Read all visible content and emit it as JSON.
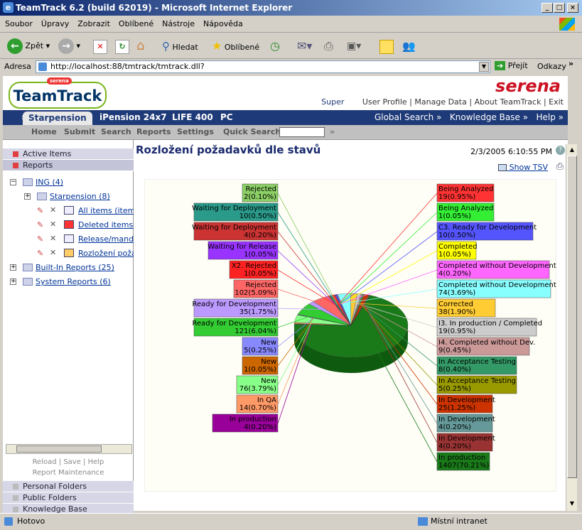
{
  "window": {
    "title": "TeamTrack 6.2 (build 62019) - Microsoft Internet Explorer",
    "min": "_",
    "max": "□",
    "close": "×"
  },
  "menu": [
    "Soubor",
    "Úpravy",
    "Zobrazit",
    "Oblíbené",
    "Nástroje",
    "Nápověda"
  ],
  "toolbar": {
    "back": "Zpět",
    "search": "Hledat",
    "favorites": "Oblíbené"
  },
  "address": {
    "label": "Adresa",
    "url": "http://localhost:88/tmtrack/tmtrack.dll?",
    "go": "Přejít",
    "links": "Odkazy"
  },
  "app": {
    "logo": "TeamTrack",
    "logo_small": "serena",
    "brand": "serena",
    "user": "Super",
    "links": [
      "User Profile",
      "Manage Data",
      "About TeamTrack",
      "Exit"
    ]
  },
  "tabs": {
    "expand": "»",
    "active": "Starpension",
    "items": [
      "iPension 24x7",
      "LIFE 400",
      "PC"
    ],
    "right": [
      "Global Search »",
      "Knowledge Base »",
      "Help »"
    ]
  },
  "subnav": {
    "items": [
      "Home",
      "Submit",
      "Search",
      "Reports",
      "Settings"
    ],
    "quick_search": "Quick Search:",
    "arrow": "»"
  },
  "sidebar": {
    "active_items": "Active Items",
    "reports": "Reports",
    "tree": {
      "root": "ING (4)",
      "child": "Starpension (8)",
      "reports": [
        "All items (item t",
        "Deleted items (N",
        "Release/manda",
        "Rozložení poža"
      ],
      "builtin": "Built-In Reports (25)",
      "system": "System Reports (6)"
    },
    "footer": {
      "reload": "Reload",
      "save": "Save",
      "help": "Help",
      "maint": "Report Maintenance"
    },
    "bottom": [
      "Personal Folders",
      "Public Folders",
      "Knowledge Base"
    ]
  },
  "report": {
    "title": "Rozložení požadavků dle stavů",
    "date": "2/3/2005 6:10:55 PM",
    "show_tsv": "Show TSV"
  },
  "colors": {
    "navy": "#1e3a78",
    "pie_main": "#1a7a1a"
  },
  "chart_data": {
    "type": "pie",
    "left": [
      {
        "name": "Rejected",
        "value": "2(0.10%)",
        "color": "#8ccf66"
      },
      {
        "name": "Waiting for Deployment",
        "value": "10(0.50%)",
        "color": "#2a9a8a"
      },
      {
        "name": "Waiting for Deployment",
        "value": "4(0.20%)",
        "color": "#cc3333"
      },
      {
        "name": "Waiting for Release",
        "value": "1(0.05%)",
        "color": "#9933ff"
      },
      {
        "name": "X2. Rejected",
        "value": "1(0.05%)",
        "color": "#ff2222"
      },
      {
        "name": "Rejected",
        "value": "102(5.09%)",
        "color": "#ff6666"
      },
      {
        "name": "Ready for Development",
        "value": "35(1.75%)",
        "color": "#bb99ff"
      },
      {
        "name": "Ready for Development",
        "value": "121(6.04%)",
        "color": "#33cc33"
      },
      {
        "name": "New",
        "value": "5(0.25%)",
        "color": "#8888ff"
      },
      {
        "name": "New",
        "value": "1(0.05%)",
        "color": "#cc6600"
      },
      {
        "name": "New",
        "value": "76(3.79%)",
        "color": "#88ff88"
      },
      {
        "name": "In QA",
        "value": "14(0.70%)",
        "color": "#ff9966"
      },
      {
        "name": "In production",
        "value": "4(0.20%)",
        "color": "#990099"
      }
    ],
    "right": [
      {
        "name": "Being Analyzed",
        "value": "19(0.95%)",
        "color": "#ff3333"
      },
      {
        "name": "Being Analyzed",
        "value": "1(0.05%)",
        "color": "#33ee33"
      },
      {
        "name": "C3. Ready for Development",
        "value": "10(0.50%)",
        "color": "#5555ff"
      },
      {
        "name": "Completed",
        "value": "1(0.05%)",
        "color": "#ffff00"
      },
      {
        "name": "Completed without Development",
        "value": "4(0.20%)",
        "color": "#ff66ff"
      },
      {
        "name": "Completed without Development",
        "value": "74(3.69%)",
        "color": "#88ffff"
      },
      {
        "name": "Corrected",
        "value": "38(1.90%)",
        "color": "#ffcc33"
      },
      {
        "name": "I3. In production / Completed",
        "value": "19(0.95%)",
        "color": "#cccccc"
      },
      {
        "name": "I4. Completed without Dev.",
        "value": "9(0.45%)",
        "color": "#cc9999"
      },
      {
        "name": "In Acceptance Testing",
        "value": "8(0.40%)",
        "color": "#339966"
      },
      {
        "name": "In Acceptance Testing",
        "value": "5(0.25%)",
        "color": "#999900"
      },
      {
        "name": "In Development",
        "value": "25(1.25%)",
        "color": "#cc3300"
      },
      {
        "name": "In Development",
        "value": "4(0.20%)",
        "color": "#669999"
      },
      {
        "name": "In Development",
        "value": "4(0.20%)",
        "color": "#993333"
      },
      {
        "name": "In production",
        "value": "1407(70.21%)",
        "color": "#1a7a1a"
      }
    ]
  },
  "status": {
    "text": "Hotovo",
    "zone": "Místní intranet"
  }
}
